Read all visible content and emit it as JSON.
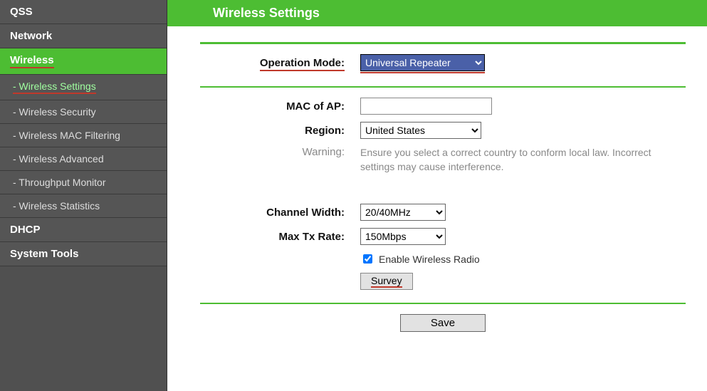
{
  "header": {
    "title": "Wireless Settings"
  },
  "sidebar": {
    "items": [
      {
        "label": "QSS",
        "type": "major"
      },
      {
        "label": "Network",
        "type": "major"
      },
      {
        "label": "Wireless",
        "type": "active-parent"
      },
      {
        "label": "- Wireless Settings",
        "type": "sub-active"
      },
      {
        "label": "- Wireless Security",
        "type": "sub"
      },
      {
        "label": "- Wireless MAC Filtering",
        "type": "sub"
      },
      {
        "label": "- Wireless Advanced",
        "type": "sub"
      },
      {
        "label": "- Throughput Monitor",
        "type": "sub"
      },
      {
        "label": "- Wireless Statistics",
        "type": "sub"
      },
      {
        "label": "DHCP",
        "type": "major"
      },
      {
        "label": "System Tools",
        "type": "major"
      }
    ]
  },
  "labels": {
    "operation_mode": "Operation Mode:",
    "mac_of_ap": "MAC of AP:",
    "region": "Region:",
    "warning": "Warning:",
    "channel_width": "Channel Width:",
    "max_tx_rate": "Max Tx Rate:",
    "enable_radio": "Enable Wireless Radio",
    "survey": "Survey",
    "save": "Save"
  },
  "form": {
    "operation_mode": "Universal Repeater",
    "mac_of_ap": "",
    "region": "United States",
    "warning_text": "Ensure you select a correct country to conform local law. Incorrect settings may cause interference.",
    "channel_width": "20/40MHz",
    "max_tx_rate": "150Mbps",
    "enable_radio_checked": true
  }
}
